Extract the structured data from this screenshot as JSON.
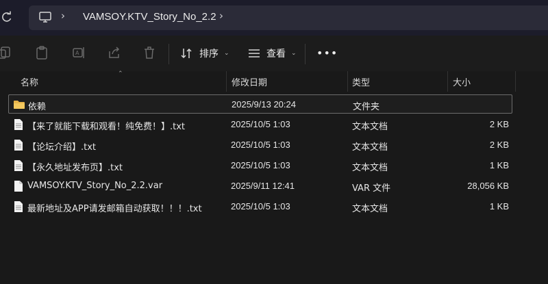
{
  "address": {
    "path": "VAMSOY.KTV_Story_No_2.2"
  },
  "toolbar": {
    "sort_label": "排序",
    "view_label": "查看",
    "more_label": "•••"
  },
  "columns": {
    "name": "名称",
    "date": "修改日期",
    "type": "类型",
    "size": "大小"
  },
  "files": [
    {
      "name": "依赖",
      "date": "2025/9/13 20:24",
      "type": "文件夹",
      "size": "",
      "icon": "folder-icon"
    },
    {
      "name": "【来了就能下载和观看！纯免费！】.txt",
      "date": "2025/10/5 1:03",
      "type": "文本文档",
      "size": "2 KB",
      "icon": "text-file-icon"
    },
    {
      "name": "【论坛介绍】.txt",
      "date": "2025/10/5 1:03",
      "type": "文本文档",
      "size": "2 KB",
      "icon": "text-file-icon"
    },
    {
      "name": "【永久地址发布页】.txt",
      "date": "2025/10/5 1:03",
      "type": "文本文档",
      "size": "1 KB",
      "icon": "text-file-icon"
    },
    {
      "name": "VAMSOY.KTV_Story_No_2.2.var",
      "date": "2025/9/11 12:41",
      "type": "VAR 文件",
      "size": "28,056 KB",
      "icon": "file-icon"
    },
    {
      "name": "最新地址及APP请发邮箱自动获取！！！.txt",
      "date": "2025/10/5 1:03",
      "type": "文本文档",
      "size": "1 KB",
      "icon": "text-file-icon"
    }
  ]
}
